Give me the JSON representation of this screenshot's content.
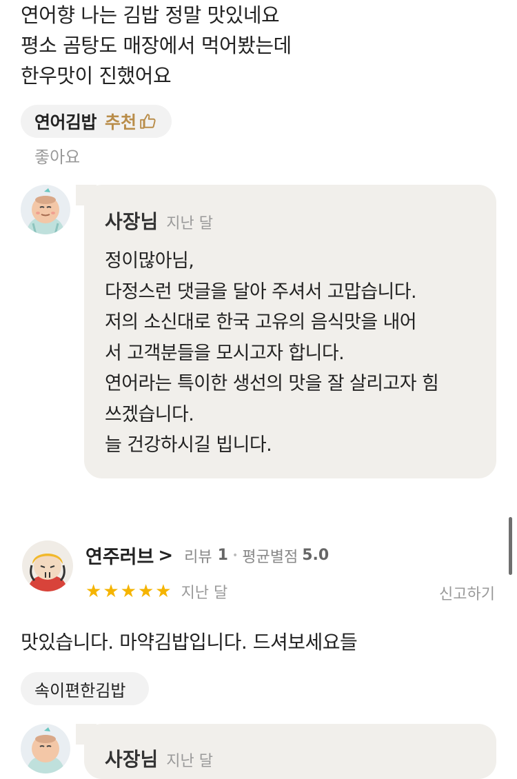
{
  "review1": {
    "lines": [
      "연어향 나는 김밥 정말 맛있네요",
      "평소 곰탕도 매장에서 먹어봤는데",
      "한우맛이 진했어요"
    ],
    "menu_tag": "연어김밥",
    "recommend_label": "추천",
    "like_label": "좋아요",
    "reply": {
      "owner_name": "사장님",
      "date": "지난 달",
      "lines": [
        "정이많아님,",
        "다정스런 댓글을 달아 주셔서 고맙습니다.",
        "저의 소신대로  한국 고유의  음식맛을  내어",
        "서 고객분들을  모시고자 합니다.",
        "연어라는 특이한 생선의 맛을 잘 살리고자 힘",
        "쓰겠습니다.",
        "늘 건강하시길 빕니다."
      ]
    }
  },
  "review2": {
    "reviewer_name": "연주러브",
    "chevron": ">",
    "review_count_label": "리뷰",
    "review_count": "1",
    "separator": "•",
    "avg_label": "평균별점",
    "avg_value": "5.0",
    "rating": 5,
    "date": "지난 달",
    "report_label": "신고하기",
    "text": "맛있습니다. 마약김밥입니다. 드셔보세요들",
    "menu_tag": "속이편한김밥",
    "reply": {
      "owner_name": "사장님",
      "date": "지난 달"
    }
  },
  "colors": {
    "bubble": "#f1efeb",
    "recommend": "#b98d4a",
    "star": "#f5b400",
    "chip": "#f2f2f2"
  },
  "icons": {
    "thumb": "thumbs-up-icon",
    "owner_avatar": "owner-avatar",
    "reviewer_avatar": "reviewer-avatar",
    "star": "star-icon"
  }
}
